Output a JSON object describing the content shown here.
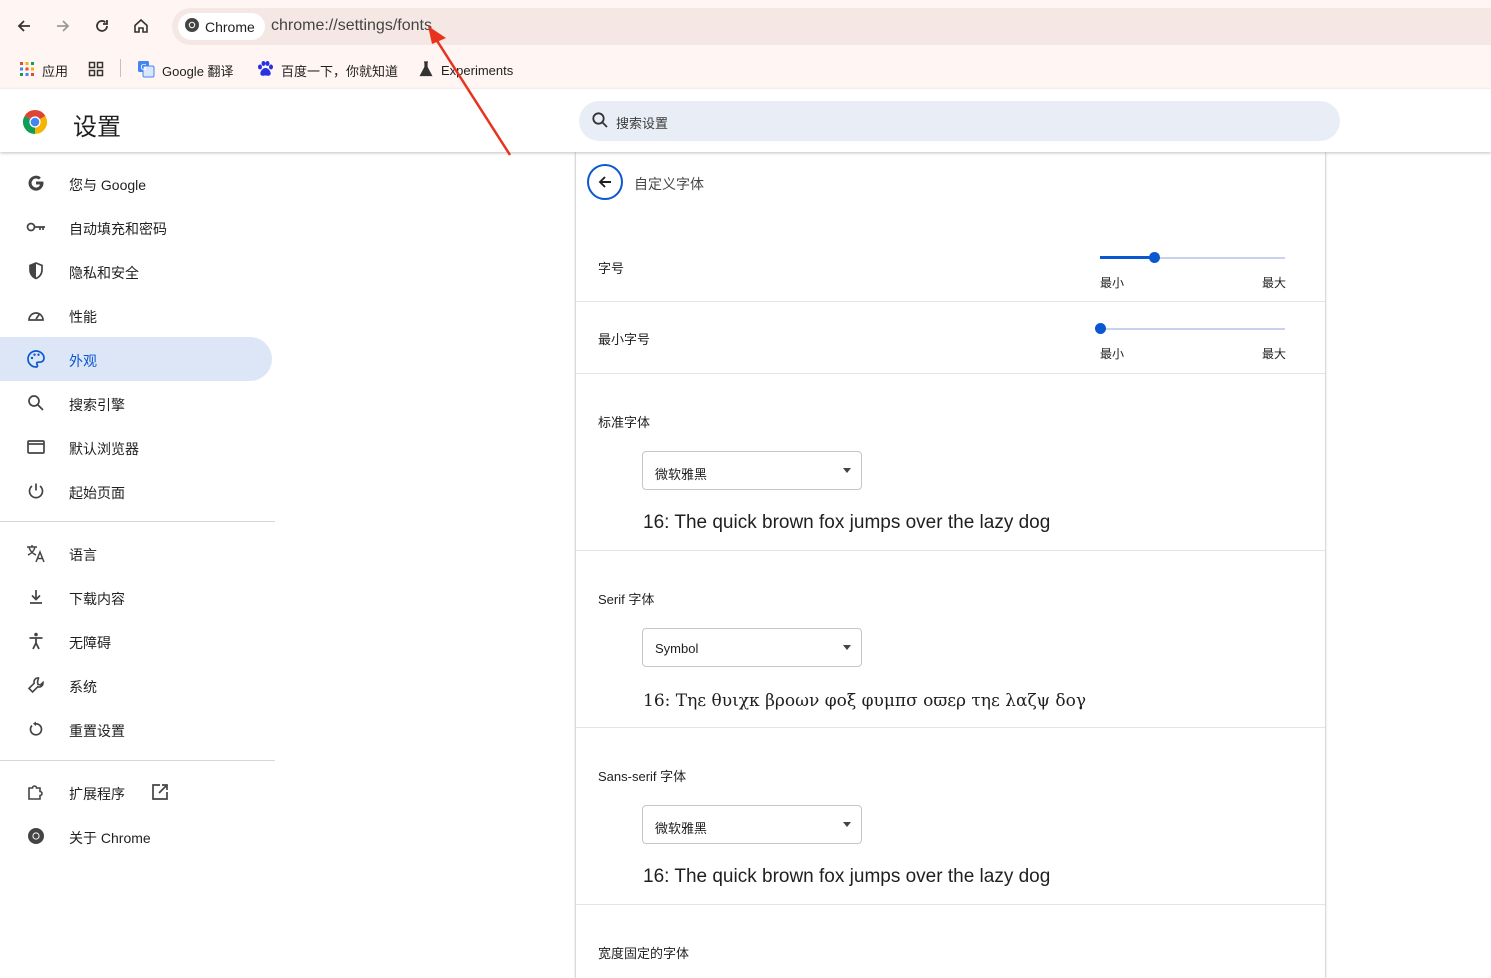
{
  "browser": {
    "chip_label": "Chrome",
    "url": "chrome://settings/fonts",
    "bookmarks": [
      {
        "label": "应用",
        "icon": "apps-grid-icon"
      },
      {
        "label": "",
        "icon": "tab-groups-icon"
      },
      {
        "label": "Google 翻译",
        "icon": "google-translate-icon"
      },
      {
        "label": "百度一下，你就知道",
        "icon": "baidu-paw-icon"
      },
      {
        "label": "Experiments",
        "icon": "flask-icon"
      }
    ]
  },
  "header": {
    "title": "设置",
    "search_placeholder": "搜索设置"
  },
  "sidebar": {
    "items": [
      {
        "label": "您与 Google",
        "icon": "google-g-icon",
        "active": false
      },
      {
        "label": "自动填充和密码",
        "icon": "key-icon",
        "active": false
      },
      {
        "label": "隐私和安全",
        "icon": "shield-icon",
        "active": false
      },
      {
        "label": "性能",
        "icon": "speedometer-icon",
        "active": false
      },
      {
        "label": "外观",
        "icon": "palette-icon",
        "active": true
      },
      {
        "label": "搜索引擎",
        "icon": "search-icon",
        "active": false
      },
      {
        "label": "默认浏览器",
        "icon": "browser-window-icon",
        "active": false
      },
      {
        "label": "起始页面",
        "icon": "power-icon",
        "active": false
      },
      {
        "label": "语言",
        "icon": "translate-icon",
        "active": false
      },
      {
        "label": "下载内容",
        "icon": "download-icon",
        "active": false
      },
      {
        "label": "无障碍",
        "icon": "accessibility-icon",
        "active": false
      },
      {
        "label": "系统",
        "icon": "wrench-icon",
        "active": false
      },
      {
        "label": "重置设置",
        "icon": "reset-icon",
        "active": false
      },
      {
        "label": "扩展程序",
        "icon": "puzzle-icon",
        "active": false
      },
      {
        "label": "关于 Chrome",
        "icon": "chrome-logo-icon",
        "active": false
      }
    ]
  },
  "fonts_page": {
    "heading": "自定义字体",
    "font_size": {
      "label": "字号",
      "min_label": "最小",
      "max_label": "最大",
      "value": 0.29
    },
    "min_font_size": {
      "label": "最小字号",
      "min_label": "最小",
      "max_label": "最大",
      "value": 0.0
    },
    "standard": {
      "label": "标准字体",
      "selected": "微软雅黑",
      "sample": "16: The quick brown fox jumps over the lazy dog"
    },
    "serif": {
      "label": "Serif 字体",
      "selected": "Symbol",
      "sample": "16: Τηε θυιχκ βροων φοξ φυμπσ οϖερ τηε λαζψ δογ"
    },
    "sans_serif": {
      "label": "Sans-serif 字体",
      "selected": "微软雅黑",
      "sample": "16: The quick brown fox jumps over the lazy dog"
    },
    "fixed_width": {
      "label": "宽度固定的字体"
    }
  },
  "colors": {
    "accent": "#0b57d0",
    "annotation": "#e8321e"
  }
}
